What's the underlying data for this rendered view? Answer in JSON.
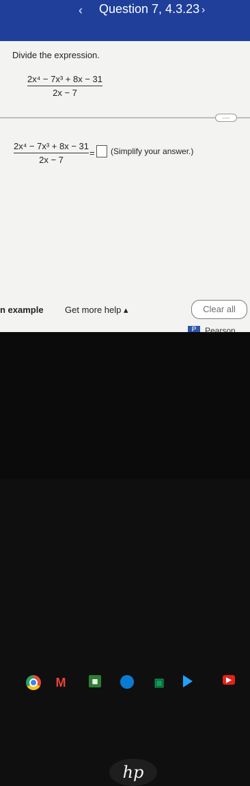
{
  "header": {
    "title": "Question 7, 4.3.23",
    "prev_glyph": "‹",
    "next_glyph": "›"
  },
  "question": {
    "prompt": "Divide the expression.",
    "expr_top_numerator": "2x⁴ − 7x³ + 8x − 31",
    "expr_top_denominator": "2x − 7",
    "expr_bottom_numerator": "2x⁴ − 7x³ + 8x − 31",
    "expr_bottom_denominator": "2x − 7",
    "equals": "=",
    "hint": "(Simplify your answer.)",
    "more_options": "...."
  },
  "footer": {
    "example": "n example",
    "get_more_help": "Get more help ▴",
    "clear_all": "Clear all",
    "brand": "Pearson"
  },
  "taskbar": {
    "icons": [
      "chrome-icon",
      "gmail-icon",
      "classroom-icon",
      "meet-icon",
      "camera-icon",
      "play-icon",
      "youtube-icon"
    ]
  },
  "device": {
    "logo": "hp"
  },
  "colors": {
    "header": "#1f3f9a",
    "background": "#f3f3f1",
    "taskbar": "#0b0b0b"
  }
}
